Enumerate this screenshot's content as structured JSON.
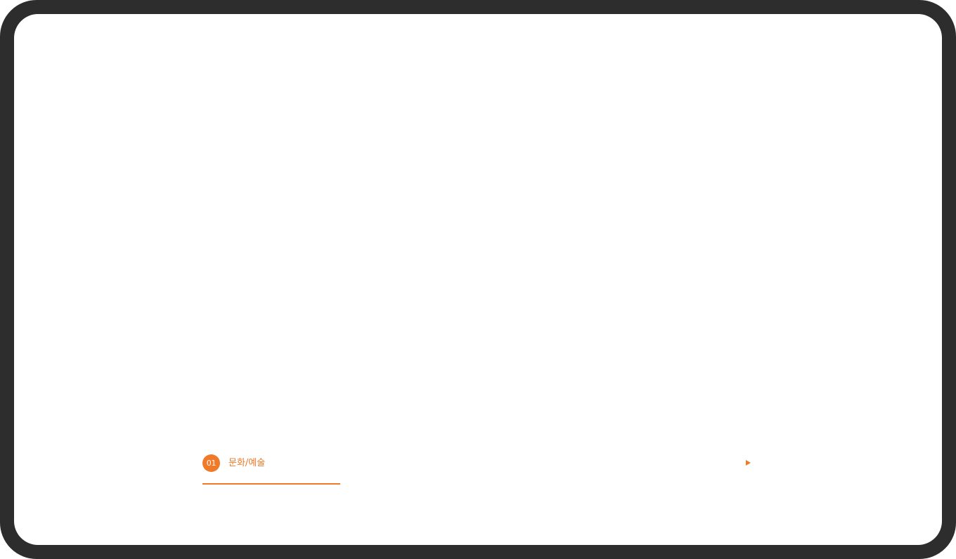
{
  "category": {
    "number": "01",
    "label": "문화/예술",
    "arrow_icon": "play-arrow-icon",
    "accent_color": "#f07a28"
  },
  "frame": {
    "bezel_color": "#2d2d2d",
    "screen_color": "#ffffff"
  }
}
